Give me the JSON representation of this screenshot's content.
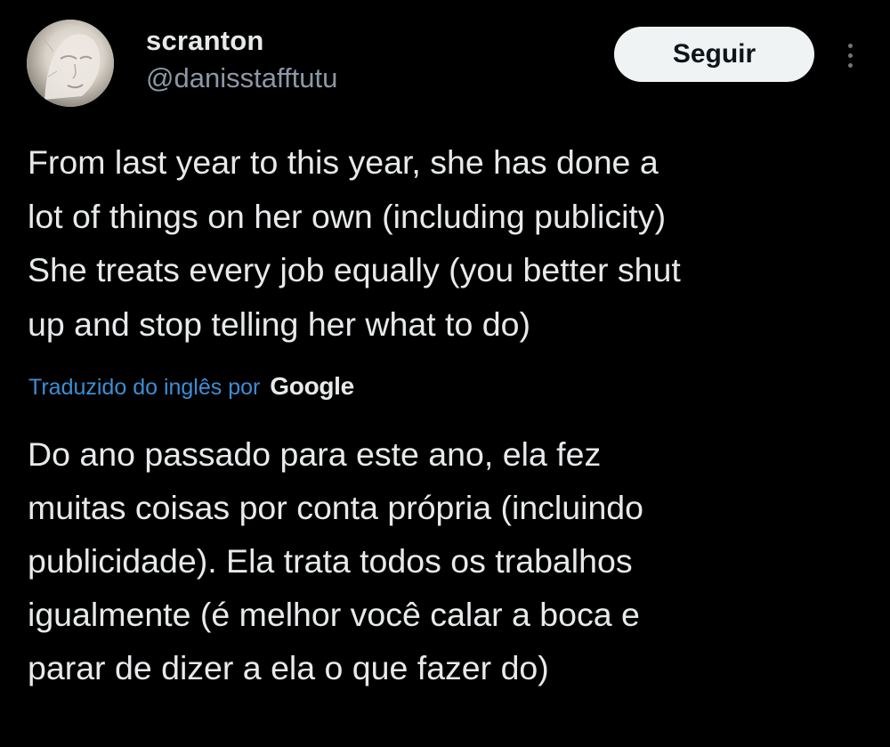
{
  "author": {
    "display_name": "scranton",
    "handle": "@danisstafftutu",
    "avatar_icon": "avatar-image"
  },
  "actions": {
    "follow_label": "Seguir",
    "more_icon": "more-vertical-icon"
  },
  "tweet": {
    "lines": [
      "From last year to this year, she has done a",
      "lot of things on her own (including publicity)",
      "She treats every job equally (you better shut",
      "up and stop telling her what to do)"
    ]
  },
  "translation": {
    "label": "Traduzido do inglês por",
    "provider": "Google",
    "lines": [
      "Do ano passado para este ano, ela fez",
      "muitas coisas por conta própria (incluindo",
      "publicidade). Ela trata todos os trabalhos",
      "igualmente (é melhor você calar a boca e",
      "parar de dizer a ela o que fazer do)"
    ]
  },
  "colors": {
    "background": "#000000",
    "text": "#e7e9ea",
    "muted": "#8b98a5",
    "link": "#3b8fd6",
    "button_bg": "#eff3f4"
  }
}
